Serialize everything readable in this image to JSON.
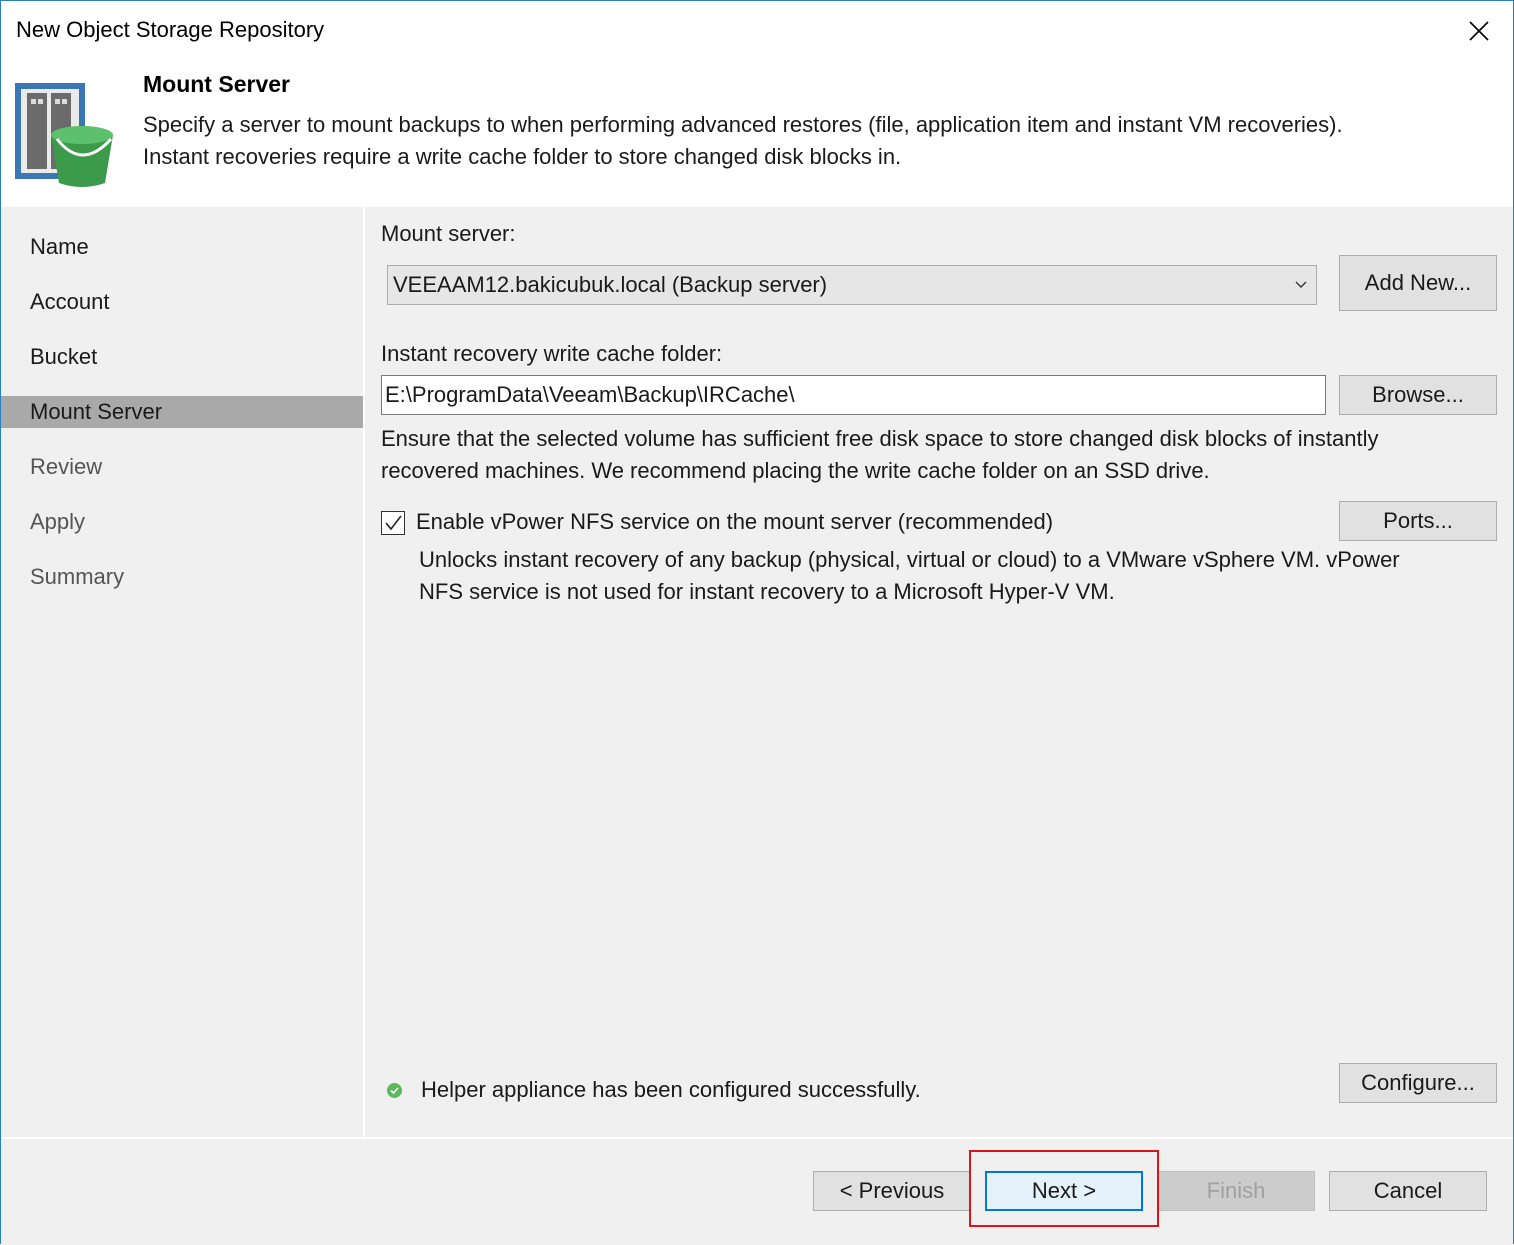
{
  "window": {
    "title": "New Object Storage Repository"
  },
  "header": {
    "title": "Mount Server",
    "description_line1": "Specify a server to mount backups to when performing advanced restores (file, application item and instant VM recoveries).",
    "description_line2": "Instant recoveries require a write cache folder to store changed disk blocks in."
  },
  "nav": {
    "items": [
      {
        "label": "Name",
        "state": "done"
      },
      {
        "label": "Account",
        "state": "done"
      },
      {
        "label": "Bucket",
        "state": "done"
      },
      {
        "label": "Mount Server",
        "state": "active"
      },
      {
        "label": "Review",
        "state": "todo"
      },
      {
        "label": "Apply",
        "state": "todo"
      },
      {
        "label": "Summary",
        "state": "todo"
      }
    ]
  },
  "mount_server": {
    "label": "Mount server:",
    "selected": "VEEAAM12.bakicubuk.local (Backup server)",
    "add_new_label": "Add New..."
  },
  "cache": {
    "label": "Instant recovery write cache folder:",
    "value": "E:\\ProgramData\\Veeam\\Backup\\IRCache\\",
    "browse_label": "Browse...",
    "note_line1": "Ensure that the selected volume has sufficient free disk space to store changed disk blocks of instantly",
    "note_line2": "recovered machines. We recommend placing the write cache folder on an SSD drive."
  },
  "vpower": {
    "checked": true,
    "label": "Enable vPower NFS service on the mount server (recommended)",
    "desc_line1": "Unlocks instant recovery of any backup (physical, virtual or cloud) to a VMware vSphere VM.  vPower",
    "desc_line2": "NFS service is not used for instant recovery to a Microsoft Hyper-V VM.",
    "ports_label": "Ports..."
  },
  "helper": {
    "status_text": "Helper appliance has been configured successfully.",
    "configure_label": "Configure..."
  },
  "footer": {
    "previous_label": "< Previous",
    "next_label": "Next >",
    "finish_label": "Finish",
    "cancel_label": "Cancel"
  },
  "colors": {
    "accent": "#0078d7",
    "highlight": "#d9141b",
    "success": "#5cb85c",
    "nav_active": "#a9a9a9"
  }
}
